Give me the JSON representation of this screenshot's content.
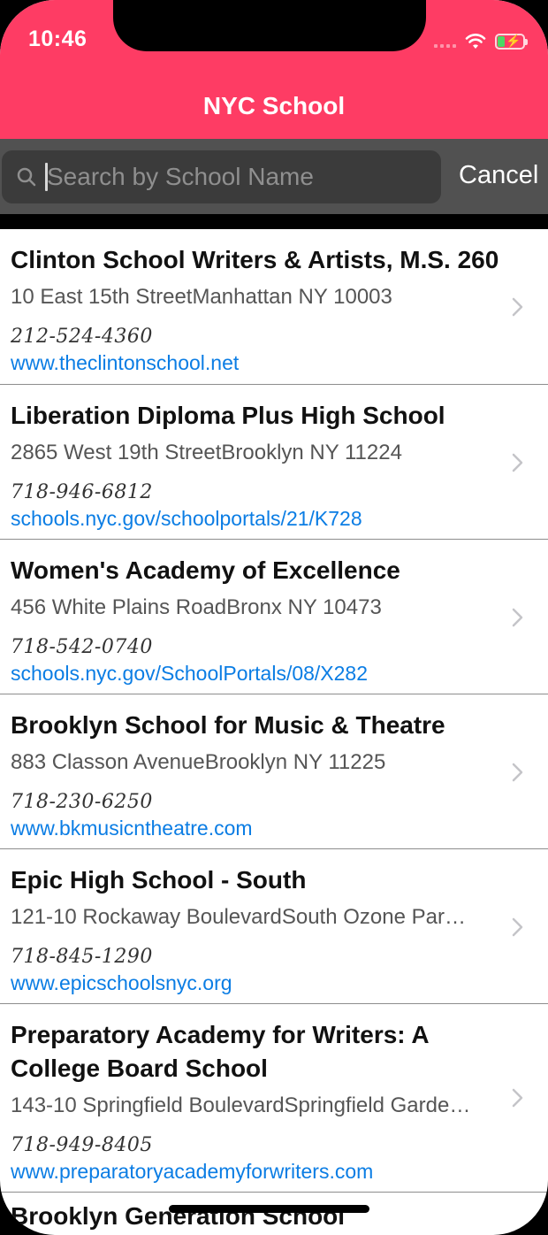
{
  "status_bar": {
    "time": "10:46"
  },
  "nav": {
    "title": "NYC School"
  },
  "search": {
    "placeholder": "Search by School Name",
    "value": "",
    "cancel_label": "Cancel"
  },
  "colors": {
    "header": "#fe3c64",
    "link": "#0b7de4",
    "searchbar": "#515151"
  },
  "schools": [
    {
      "name": "Clinton School Writers & Artists, M.S. 260",
      "address": "10 East 15th StreetManhattan NY 10003",
      "phone": "212-524-4360",
      "website": "www.theclintonschool.net"
    },
    {
      "name": "Liberation Diploma Plus High School",
      "address": "2865 West 19th StreetBrooklyn NY 11224",
      "phone": "718-946-6812",
      "website": "schools.nyc.gov/schoolportals/21/K728"
    },
    {
      "name": "Women's Academy of Excellence",
      "address": "456 White Plains RoadBronx NY 10473",
      "phone": "718-542-0740",
      "website": "schools.nyc.gov/SchoolPortals/08/X282"
    },
    {
      "name": "Brooklyn School for Music & Theatre",
      "address": "883 Classon AvenueBrooklyn NY 11225",
      "phone": "718-230-6250",
      "website": "www.bkmusicntheatre.com"
    },
    {
      "name": "Epic High School - South",
      "address": "121-10 Rockaway BoulevardSouth Ozone Par…",
      "phone": "718-845-1290",
      "website": "www.epicschoolsnyc.org"
    },
    {
      "name": "Preparatory Academy for Writers: A College Board School",
      "address": "143-10 Springfield BoulevardSpringfield Garde…",
      "phone": "718-949-8405",
      "website": "www.preparatoryacademyforwriters.com"
    },
    {
      "name": "Brooklyn Generation School",
      "address": "",
      "phone": "",
      "website": ""
    }
  ]
}
